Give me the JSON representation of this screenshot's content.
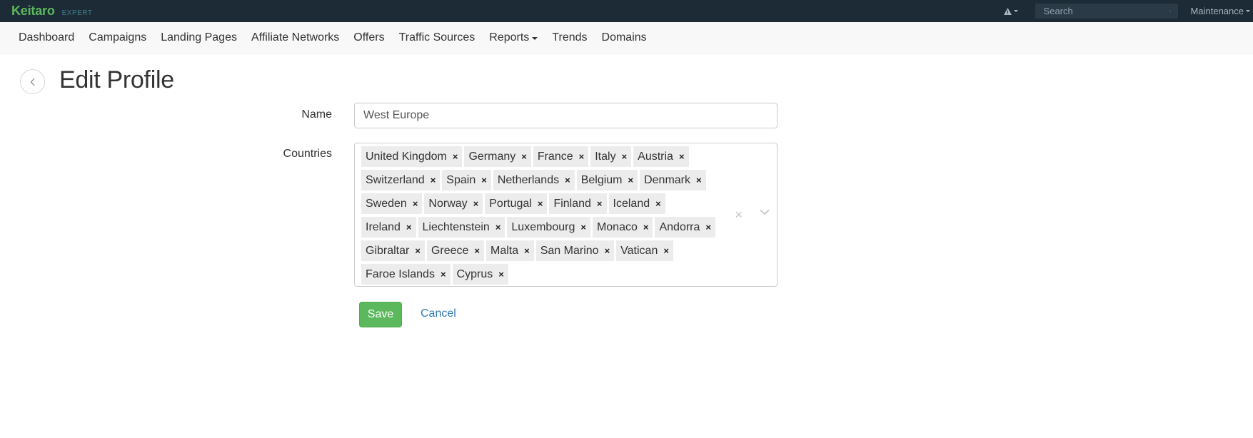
{
  "brand": {
    "name": "Keitaro",
    "edition": "EXPERT"
  },
  "topbar": {
    "search_placeholder": "Search",
    "user_menu": "Maintenance",
    "alert_icon": "warning-icon"
  },
  "nav": {
    "items": [
      {
        "label": "Dashboard"
      },
      {
        "label": "Campaigns"
      },
      {
        "label": "Landing Pages"
      },
      {
        "label": "Affiliate Networks"
      },
      {
        "label": "Offers"
      },
      {
        "label": "Traffic Sources"
      },
      {
        "label": "Reports",
        "dropdown": true
      },
      {
        "label": "Trends"
      },
      {
        "label": "Domains"
      }
    ]
  },
  "page": {
    "title": "Edit Profile"
  },
  "form": {
    "name_label": "Name",
    "name_value": "West Europe",
    "countries_label": "Countries",
    "countries": [
      "United Kingdom",
      "Germany",
      "France",
      "Italy",
      "Austria",
      "Switzerland",
      "Spain",
      "Netherlands",
      "Belgium",
      "Denmark",
      "Sweden",
      "Norway",
      "Portugal",
      "Finland",
      "Iceland",
      "Ireland",
      "Liechtenstein",
      "Luxembourg",
      "Monaco",
      "Andorra",
      "Gibraltar",
      "Greece",
      "Malta",
      "San Marino",
      "Vatican",
      "Faroe Islands",
      "Cyprus"
    ],
    "remove_glyph": "×",
    "clear_glyph": "×",
    "save_label": "Save",
    "cancel_label": "Cancel"
  },
  "colors": {
    "topbar_bg": "#1c2b36",
    "brand": "#5cb85c",
    "save_bg": "#5cb85c",
    "link": "#337ab7"
  }
}
